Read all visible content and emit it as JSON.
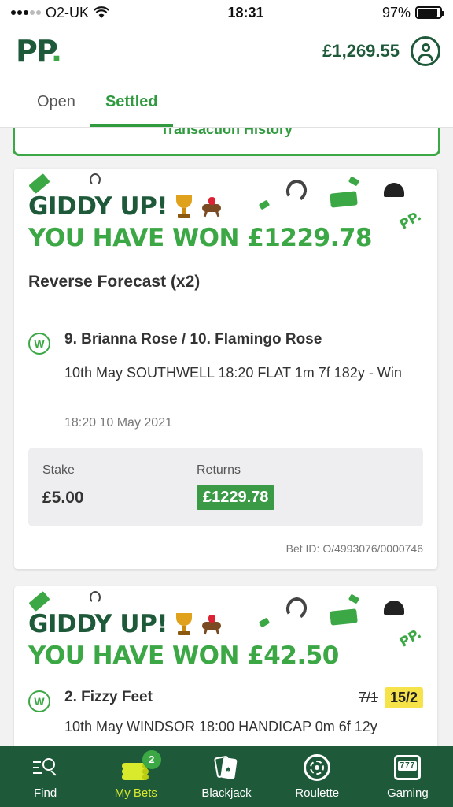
{
  "status_bar": {
    "carrier": "O2-UK",
    "time": "18:31",
    "battery": "97%"
  },
  "header": {
    "logo": "PP",
    "balance": "£1,269.55"
  },
  "tabs": [
    {
      "label": "Open",
      "active": false
    },
    {
      "label": "Settled",
      "active": true
    }
  ],
  "transaction_history": {
    "label": "Transaction History"
  },
  "bets": [
    {
      "banner_line1": "GIDDY UP!",
      "banner_line2": "YOU HAVE WON £1229.78",
      "brand_mark": "PP.",
      "bet_type": "Reverse Forecast (x2)",
      "result_badge": "W",
      "selection": "9. Brianna Rose / 10. Flamingo Rose",
      "event": "10th May SOUTHWELL 18:20 FLAT 1m 7f 182y - Win",
      "placed_time": "18:20 10 May 2021",
      "stake_label": "Stake",
      "stake": "£5.00",
      "returns_label": "Returns",
      "returns": "£1229.78",
      "bet_id": "Bet ID: O/4993076/0000746"
    },
    {
      "banner_line1": "GIDDY UP!",
      "banner_line2": "YOU HAVE WON £42.50",
      "brand_mark": "PP.",
      "result_badge": "W",
      "selection": "2. Fizzy Feet",
      "odds_old": "7/1",
      "odds_new": "15/2",
      "event": "10th May WINDSOR 18:00 HANDICAP 0m 6f 12y"
    }
  ],
  "bottom_nav": [
    {
      "label": "Find",
      "icon": "find-icon",
      "active": false
    },
    {
      "label": "My Bets",
      "icon": "my-bets-icon",
      "active": true,
      "badge": "2"
    },
    {
      "label": "Blackjack",
      "icon": "blackjack-icon",
      "active": false
    },
    {
      "label": "Roulette",
      "icon": "roulette-icon",
      "active": false
    },
    {
      "label": "Gaming",
      "icon": "gaming-icon",
      "active": false
    }
  ],
  "colors": {
    "brand_dark_green": "#1e5a3a",
    "brand_green": "#3ca845",
    "active_nav": "#d9ea2d",
    "odds_highlight": "#f6e34a"
  }
}
